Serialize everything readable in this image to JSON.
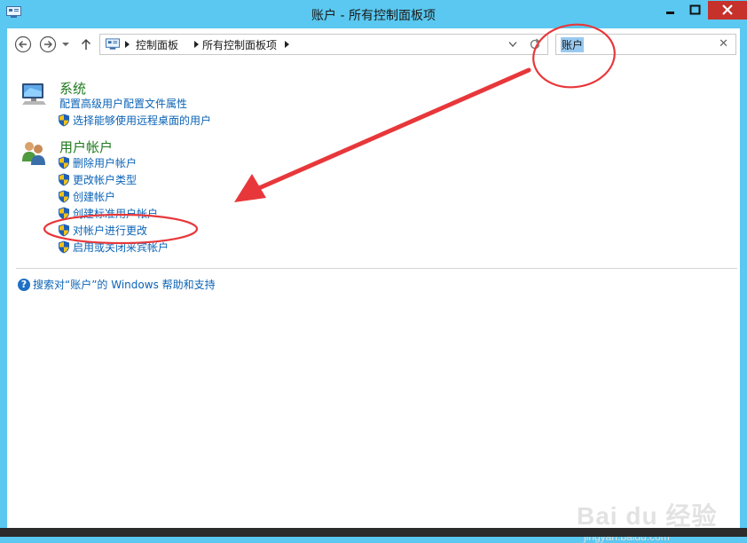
{
  "window": {
    "title": "账户 - 所有控制面板项"
  },
  "address": {
    "crumbs": [
      "控制面板",
      "所有控制面板项"
    ]
  },
  "search": {
    "value": "账户",
    "clear": "✕"
  },
  "categories": [
    {
      "title": "系统",
      "links": [
        {
          "label": "配置高级用户配置文件属性",
          "shield": false
        },
        {
          "label": "选择能够使用远程桌面的用户",
          "shield": true
        }
      ]
    },
    {
      "title": "用户帐户",
      "links": [
        {
          "label": "删除用户帐户",
          "shield": true
        },
        {
          "label": "更改帐户类型",
          "shield": true
        },
        {
          "label": "创建帐户",
          "shield": true
        },
        {
          "label": "创建标准用户帐户",
          "shield": true
        },
        {
          "label": "对帐户进行更改",
          "shield": true
        },
        {
          "label": "启用或关闭来宾帐户",
          "shield": true
        }
      ]
    }
  ],
  "help": {
    "label": "搜索对“账户”的 Windows 帮助和支持"
  },
  "watermark": {
    "brand": "Bai du 经验",
    "url": "jingyan.baidu.com"
  },
  "colors": {
    "titlebar": "#5ac8f0",
    "link": "#0b63b6",
    "category": "#1e7a1e",
    "annotation": "#e8373a"
  }
}
